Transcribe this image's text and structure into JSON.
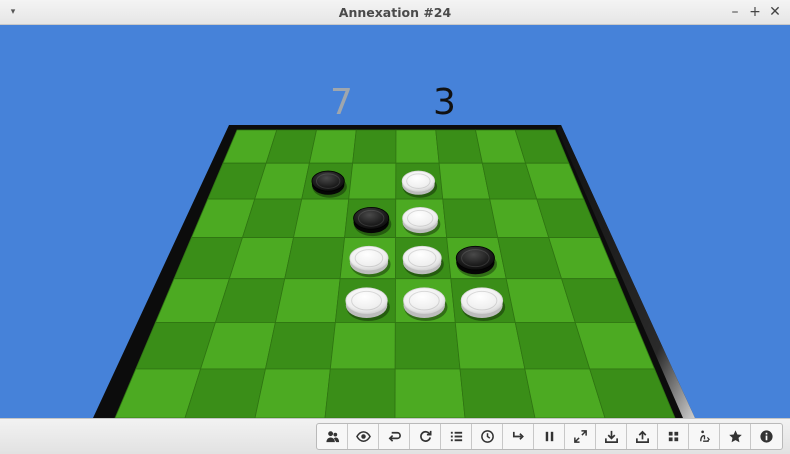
{
  "window": {
    "title": "Annexation #24",
    "buttons": {
      "menu": "▾",
      "minimize": "–",
      "maximize": "+",
      "close": "✕"
    }
  },
  "scores": {
    "white": "7",
    "black": "3"
  },
  "colors": {
    "background": "#4682d9",
    "board_light": "#4caa22",
    "board_dark": "#3a8e18",
    "board_rim": "#0c0c0c",
    "white_piece": "#f4f4f4",
    "black_piece": "#161616"
  },
  "board": {
    "visible_rows": 7,
    "visible_cols": 8,
    "pieces": [
      {
        "row": 1,
        "col": 2,
        "color": "black"
      },
      {
        "row": 1,
        "col": 4,
        "color": "white"
      },
      {
        "row": 2,
        "col": 3,
        "color": "black"
      },
      {
        "row": 2,
        "col": 4,
        "color": "white"
      },
      {
        "row": 3,
        "col": 3,
        "color": "white"
      },
      {
        "row": 3,
        "col": 4,
        "color": "white"
      },
      {
        "row": 3,
        "col": 5,
        "color": "black"
      },
      {
        "row": 4,
        "col": 3,
        "color": "white"
      },
      {
        "row": 4,
        "col": 4,
        "color": "white"
      },
      {
        "row": 4,
        "col": 5,
        "color": "white"
      }
    ]
  },
  "toolbar": [
    {
      "name": "players",
      "icon": "players-icon"
    },
    {
      "name": "view",
      "icon": "eye-icon"
    },
    {
      "name": "undo",
      "icon": "undo-icon"
    },
    {
      "name": "restart",
      "icon": "restart-icon"
    },
    {
      "name": "history",
      "icon": "list-icon"
    },
    {
      "name": "clock",
      "icon": "clock-icon"
    },
    {
      "name": "redo",
      "icon": "redo-icon"
    },
    {
      "name": "pause",
      "icon": "pause-icon"
    },
    {
      "name": "fullscreen",
      "icon": "fullscreen-icon"
    },
    {
      "name": "save",
      "icon": "save-icon"
    },
    {
      "name": "upload",
      "icon": "upload-icon"
    },
    {
      "name": "grid",
      "icon": "grid-icon"
    },
    {
      "name": "hint",
      "icon": "hint-icon"
    },
    {
      "name": "favorite",
      "icon": "star-icon"
    },
    {
      "name": "info",
      "icon": "info-icon"
    }
  ]
}
